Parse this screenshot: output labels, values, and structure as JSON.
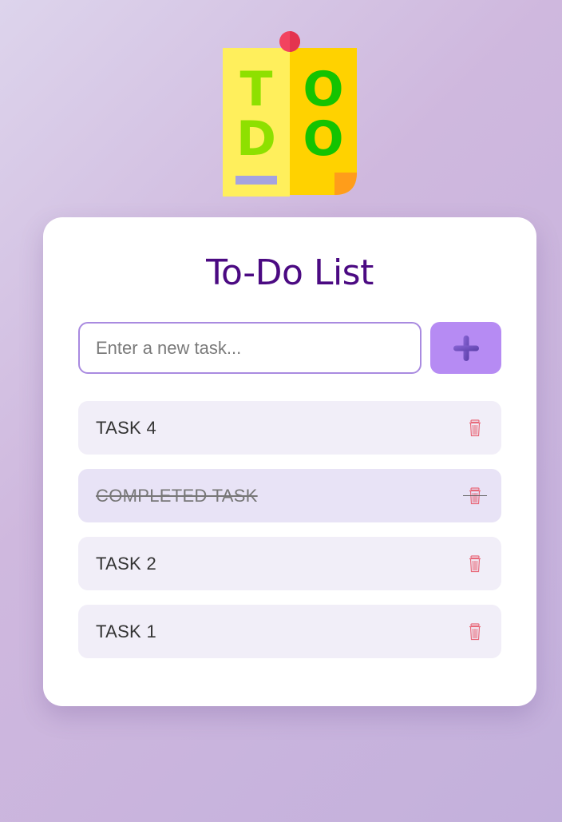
{
  "logo": {
    "letters": [
      "T",
      "O",
      "D",
      "O"
    ],
    "icon": "todo-note-icon"
  },
  "title": "To-Do List",
  "input": {
    "placeholder": "Enter a new task...",
    "value": ""
  },
  "add_button": {
    "icon": "plus-icon"
  },
  "tasks": [
    {
      "text": "TASK 4",
      "completed": false
    },
    {
      "text": "COMPLETED TASK",
      "completed": true
    },
    {
      "text": "TASK 2",
      "completed": false
    },
    {
      "text": "TASK 1",
      "completed": false
    }
  ],
  "colors": {
    "title": "#4b0a82",
    "accent": "#b68bf3",
    "input_border": "#a98ae0",
    "delete_icon": "#e8697a",
    "task_bg": "#f1eef8",
    "completed_bg": "#e8e3f6"
  }
}
